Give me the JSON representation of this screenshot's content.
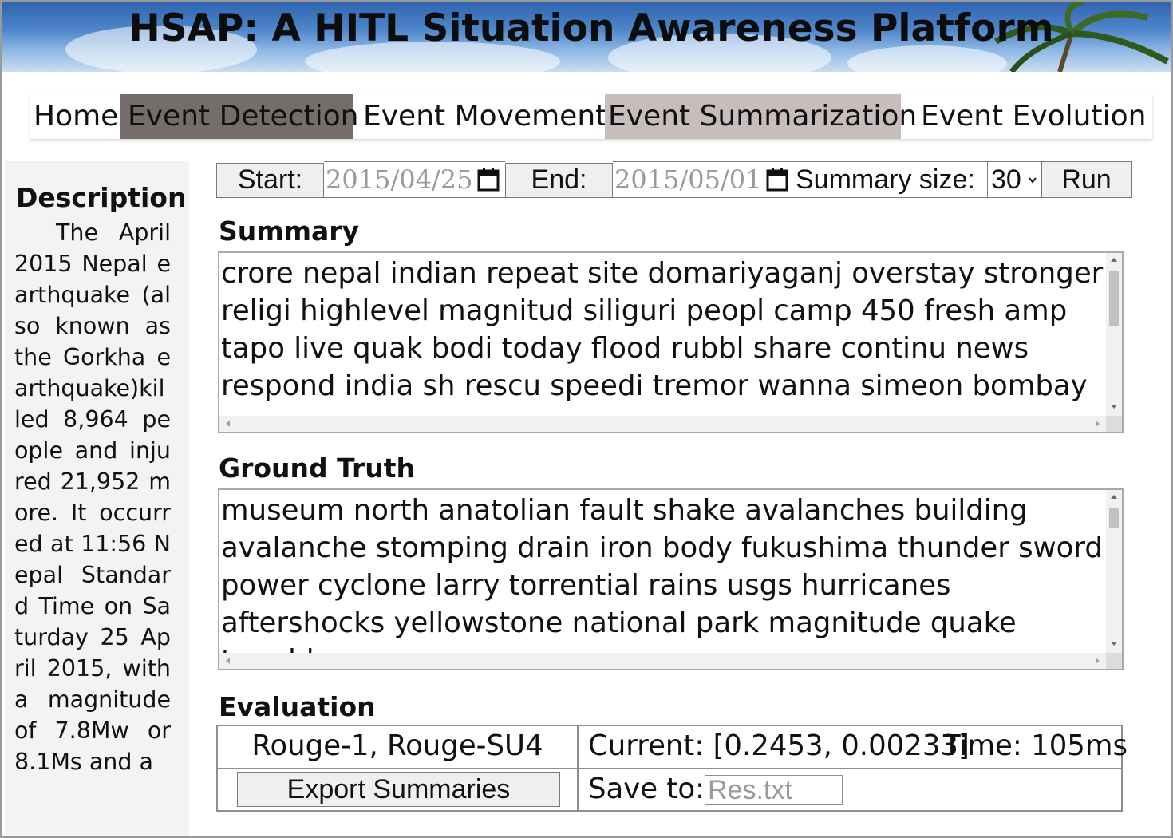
{
  "banner": {
    "title": "HSAP: A HITL Situation Awareness Platform"
  },
  "nav": {
    "items": [
      {
        "label": "Home",
        "state": "normal"
      },
      {
        "label": "Event Detection",
        "state": "active-dark"
      },
      {
        "label": "Event Movement",
        "state": "normal"
      },
      {
        "label": "Event Summarization",
        "state": "active-light"
      },
      {
        "label": "Event Evolution",
        "state": "normal"
      }
    ]
  },
  "sidebar": {
    "heading": "Description",
    "text": "The April 2015 Nepal earthquake (also known as the Gorkha earthquake)killed 8,964 people and injured 21,952 more. It occurred at 11:56 Nepal Standard Time on Saturday 25 April 2015, with a magnitude of 7.8Mw or 8.1Ms and a"
  },
  "controls": {
    "start_label": "Start:",
    "start_date": "2015/04/25",
    "end_label": "End:",
    "end_date": "2015/05/01",
    "summary_size_label": "Summary size:",
    "summary_size_value": "30",
    "run_label": "Run"
  },
  "summary": {
    "title": "Summary",
    "text": "crore nepal indian repeat site domariyaganj overstay stronger religi highlevel magnitud siliguri peopl camp 450 fresh amp tapo live quak bodi today flood rubbl share continu news respond india sh rescu speedi tremor wanna simeon bombay"
  },
  "ground_truth": {
    "title": "Ground Truth",
    "text": "museum north anatolian fault shake avalanches building avalanche stomping drain iron body fukushima thunder sword power cyclone larry torrential rains usgs hurricanes aftershocks yellowstone national park magnitude quake trembler waves"
  },
  "evaluation": {
    "title": "Evaluation",
    "metric_label": "Rouge-1, Rouge-SU4",
    "current_text": "Current: [0.2453, 0.00233]",
    "time_text": "Time: 105ms",
    "export_label": "Export Summaries",
    "save_label": "Save to:",
    "save_placeholder": "Res.txt"
  },
  "colors": {
    "nav_active_dark": "#756d6b",
    "nav_active_light": "#c7bdbc",
    "sidebar_bg": "#f4f3f2"
  }
}
